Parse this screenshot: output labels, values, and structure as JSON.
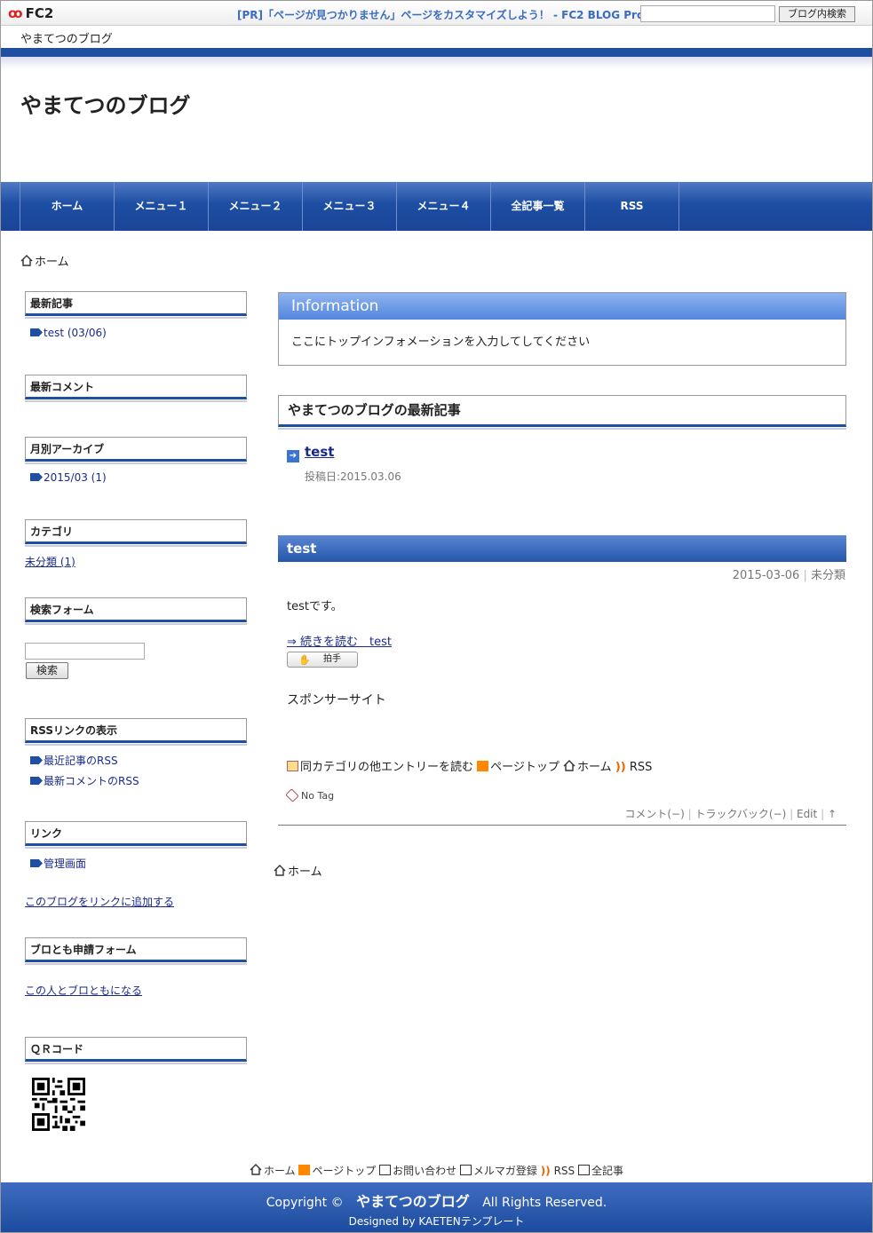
{
  "fc2bar": {
    "logo": "FC2",
    "pr_text": "[PR]「ページが見つかりません」ページをカスタマイズしよう！ - FC2 BLOG Pro",
    "search_button": "ブログ内検索",
    "blog_name": "やまてつのブログ"
  },
  "header": {
    "title": "やまてつのブログ"
  },
  "nav": [
    "ホーム",
    "メニュー１",
    "メニュー２",
    "メニュー３",
    "メニュー４",
    "全記事一覧",
    "RSS"
  ],
  "breadcrumb": {
    "home": "ホーム"
  },
  "sidebar": {
    "recent_entries": {
      "title": "最新記事",
      "items": [
        "test (03/06)"
      ]
    },
    "recent_comments": {
      "title": "最新コメント"
    },
    "archives": {
      "title": "月別アーカイブ",
      "items": [
        "2015/03 (1)"
      ]
    },
    "categories": {
      "title": "カテゴリ",
      "items": [
        "未分類 (1)"
      ]
    },
    "search": {
      "title": "検索フォーム",
      "button": "検索"
    },
    "rss": {
      "title": "RSSリンクの表示",
      "items": [
        "最近記事のRSS",
        "最新コメントのRSS"
      ]
    },
    "links": {
      "title": "リンク",
      "items": [
        "管理画面"
      ],
      "add_link": "このブログをリンクに追加する"
    },
    "friend": {
      "title": "ブロとも申請フォーム",
      "link": "この人とブロともになる"
    },
    "qr": {
      "title": "ＱＲコード"
    }
  },
  "info": {
    "title": "Information",
    "text": "ここにトップインフォメーションを入力してしてください"
  },
  "latest": {
    "title": "やまてつのブログの最新記事",
    "entry_title": "test",
    "entry_date": "投稿日:2015.03.06"
  },
  "entry": {
    "title": "test",
    "date": "2015-03-06",
    "separator": "|",
    "category": "未分類",
    "body": "testです。",
    "read_more": "⇒ 続きを読む　test",
    "clap": "拍手",
    "sponsor": "スポンサーサイト",
    "nav_other": "同カテゴリの他エントリーを読む",
    "nav_top": "ページトップ",
    "nav_home": "ホーム",
    "nav_rss": "RSS",
    "tag": "No Tag",
    "comment": "コメント(−)",
    "trackback": "トラックバック(−)",
    "edit": "Edit",
    "up": "↑"
  },
  "bottom_links": [
    "ホーム",
    "ページトップ",
    "お問い合わせ",
    "メルマガ登録",
    "RSS",
    "全記事"
  ],
  "footer": {
    "copyright": "Copyright ©",
    "blog_name": "やまてつのブログ",
    "rights": "All Rights Reserved.",
    "designed": "Designed by KAETENテンプレート"
  },
  "colors": {
    "accent": "#1f4fa0",
    "info_head": "#5386df",
    "link": "#1a2a8a"
  }
}
